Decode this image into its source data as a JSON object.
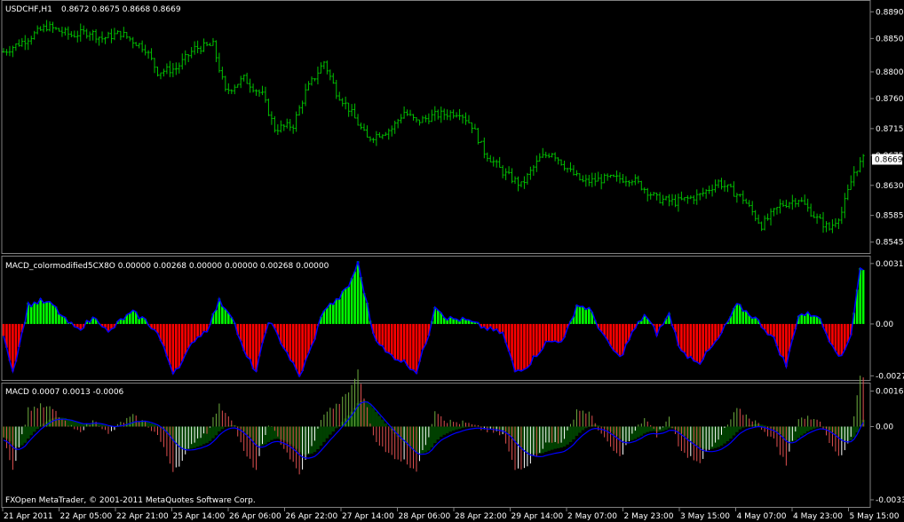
{
  "header": {
    "symbol": "USDCHF,H1",
    "ohlc": "0.8672 0.8675 0.8668 0.8669"
  },
  "macd_color_pane": {
    "title": "MACD_colormodified5CX8O 0.00000 0.00268 0.00000 0.00000 0.00268 0.00000"
  },
  "macd_pane": {
    "title": "MACD 0.0007 0.0013 -0.0006"
  },
  "copyright": "FXOpen MetaTrader, © 2001-2011 MetaQuotes Software Corp.",
  "colors": {
    "background": "#000000",
    "grid_border": "#808080",
    "candles": "#00c000",
    "hist_up": "#00ff00",
    "hist_down": "#ff0000",
    "line_blue": "#0000ff",
    "signal_fill": "#004000",
    "stripe_red": "#e05050",
    "stripe_green": "#6fae3f",
    "stripe_white": "#ffffff"
  },
  "chart_data": [
    {
      "type": "ohlc",
      "name": "price",
      "ylim": [
        0.853,
        0.8905
      ],
      "y_ticks": [
        "0.8890",
        "0.8850",
        "0.8800",
        "0.8760",
        "0.8715",
        "0.8675",
        "0.8630",
        "0.8585",
        "0.8545"
      ],
      "y_tick_values": [
        0.889,
        0.885,
        0.88,
        0.876,
        0.8715,
        0.8675,
        0.863,
        0.8585,
        0.8545
      ],
      "last_price_label": "0.8669",
      "last_price": 0.8669,
      "x_labels": [
        "21 Apr 2011",
        "22 Apr 05:00",
        "22 Apr 21:00",
        "25 Apr 14:00",
        "26 Apr 06:00",
        "26 Apr 22:00",
        "27 Apr 14:00",
        "28 Apr 06:00",
        "28 Apr 22:00",
        "29 Apr 14:00",
        "2 May 07:00",
        "2 May 23:00",
        "3 May 15:00",
        "4 May 07:00",
        "4 May 23:00",
        "5 May 15:00"
      ],
      "close_anchors": [
        [
          0,
          0.883
        ],
        [
          6,
          0.8845
        ],
        [
          14,
          0.8868
        ],
        [
          22,
          0.8855
        ],
        [
          28,
          0.886
        ],
        [
          32,
          0.885
        ],
        [
          38,
          0.8858
        ],
        [
          46,
          0.8835
        ],
        [
          50,
          0.88
        ],
        [
          56,
          0.8805
        ],
        [
          62,
          0.8835
        ],
        [
          68,
          0.884
        ],
        [
          72,
          0.877
        ],
        [
          78,
          0.879
        ],
        [
          84,
          0.8765
        ],
        [
          88,
          0.8715
        ],
        [
          94,
          0.872
        ],
        [
          98,
          0.877
        ],
        [
          102,
          0.88
        ],
        [
          104,
          0.8815
        ],
        [
          108,
          0.877
        ],
        [
          112,
          0.8745
        ],
        [
          118,
          0.87
        ],
        [
          126,
          0.8715
        ],
        [
          130,
          0.874
        ],
        [
          134,
          0.8725
        ],
        [
          140,
          0.8735
        ],
        [
          148,
          0.874
        ],
        [
          152,
          0.872
        ],
        [
          156,
          0.868
        ],
        [
          162,
          0.865
        ],
        [
          168,
          0.863
        ],
        [
          174,
          0.867
        ],
        [
          178,
          0.868
        ],
        [
          184,
          0.865
        ],
        [
          188,
          0.8635
        ],
        [
          196,
          0.864
        ],
        [
          204,
          0.864
        ],
        [
          212,
          0.861
        ],
        [
          218,
          0.8605
        ],
        [
          226,
          0.8615
        ],
        [
          232,
          0.8635
        ],
        [
          240,
          0.861
        ],
        [
          246,
          0.857
        ],
        [
          252,
          0.86
        ],
        [
          258,
          0.861
        ],
        [
          264,
          0.858
        ],
        [
          268,
          0.8565
        ],
        [
          272,
          0.859
        ],
        [
          276,
          0.865
        ],
        [
          279,
          0.8669
        ]
      ]
    },
    {
      "type": "histogram",
      "name": "macd_colormodified",
      "ylim": [
        -0.0029,
        0.0035
      ],
      "y_ticks": [
        "0.00318",
        "0.00",
        "-0.00273"
      ],
      "y_tick_values": [
        0.00318,
        0.0,
        -0.00273
      ],
      "value_anchors": [
        [
          0,
          -0.0005
        ],
        [
          3,
          -0.0025
        ],
        [
          6,
          -0.0005
        ],
        [
          8,
          0.001
        ],
        [
          12,
          0.0012
        ],
        [
          16,
          0.001
        ],
        [
          20,
          0.0002
        ],
        [
          24,
          -0.0003
        ],
        [
          30,
          0.0004
        ],
        [
          34,
          -0.0005
        ],
        [
          38,
          0.0002
        ],
        [
          42,
          0.0006
        ],
        [
          46,
          0.0002
        ],
        [
          50,
          -0.0005
        ],
        [
          55,
          -0.0025
        ],
        [
          58,
          -0.002
        ],
        [
          62,
          -0.0008
        ],
        [
          66,
          -0.0003
        ],
        [
          70,
          0.0012
        ],
        [
          74,
          0.0005
        ],
        [
          78,
          -0.0015
        ],
        [
          82,
          -0.0025
        ],
        [
          86,
          0.0002
        ],
        [
          92,
          -0.0015
        ],
        [
          96,
          -0.0028
        ],
        [
          100,
          -0.0012
        ],
        [
          104,
          0.0008
        ],
        [
          108,
          0.0012
        ],
        [
          112,
          0.002
        ],
        [
          115,
          0.0032
        ],
        [
          118,
          0.001
        ],
        [
          120,
          -0.0005
        ],
        [
          124,
          -0.0015
        ],
        [
          130,
          -0.002
        ],
        [
          134,
          -0.0025
        ],
        [
          138,
          -0.0005
        ],
        [
          140,
          0.001
        ],
        [
          144,
          0.0003
        ],
        [
          150,
          0.0002
        ],
        [
          156,
          -0.0002
        ],
        [
          162,
          -0.0005
        ],
        [
          166,
          -0.0025
        ],
        [
          170,
          -0.0022
        ],
        [
          176,
          -0.001
        ],
        [
          182,
          -0.0008
        ],
        [
          186,
          0.001
        ],
        [
          190,
          0.0008
        ],
        [
          196,
          -0.001
        ],
        [
          200,
          -0.0018
        ],
        [
          204,
          -0.0005
        ],
        [
          208,
          0.0005
        ],
        [
          212,
          -0.0005
        ],
        [
          216,
          0.0005
        ],
        [
          220,
          -0.0015
        ],
        [
          226,
          -0.002
        ],
        [
          232,
          -0.0008
        ],
        [
          238,
          0.001
        ],
        [
          244,
          0.0003
        ],
        [
          250,
          -0.0008
        ],
        [
          254,
          -0.0022
        ],
        [
          258,
          0.0005
        ],
        [
          264,
          0.0005
        ],
        [
          268,
          -0.0008
        ],
        [
          272,
          -0.0018
        ],
        [
          275,
          -0.0005
        ],
        [
          278,
          0.003
        ],
        [
          279,
          0.0028
        ]
      ]
    },
    {
      "type": "histogram",
      "name": "macd",
      "ylim": [
        -0.0035,
        0.0019
      ],
      "y_ticks": [
        "0.0016",
        "0.00",
        "-0.0033"
      ],
      "y_tick_values": [
        0.0016,
        0.0,
        -0.0033
      ],
      "title": "MACD 0.0007 0.0013 -0.0006"
    }
  ]
}
